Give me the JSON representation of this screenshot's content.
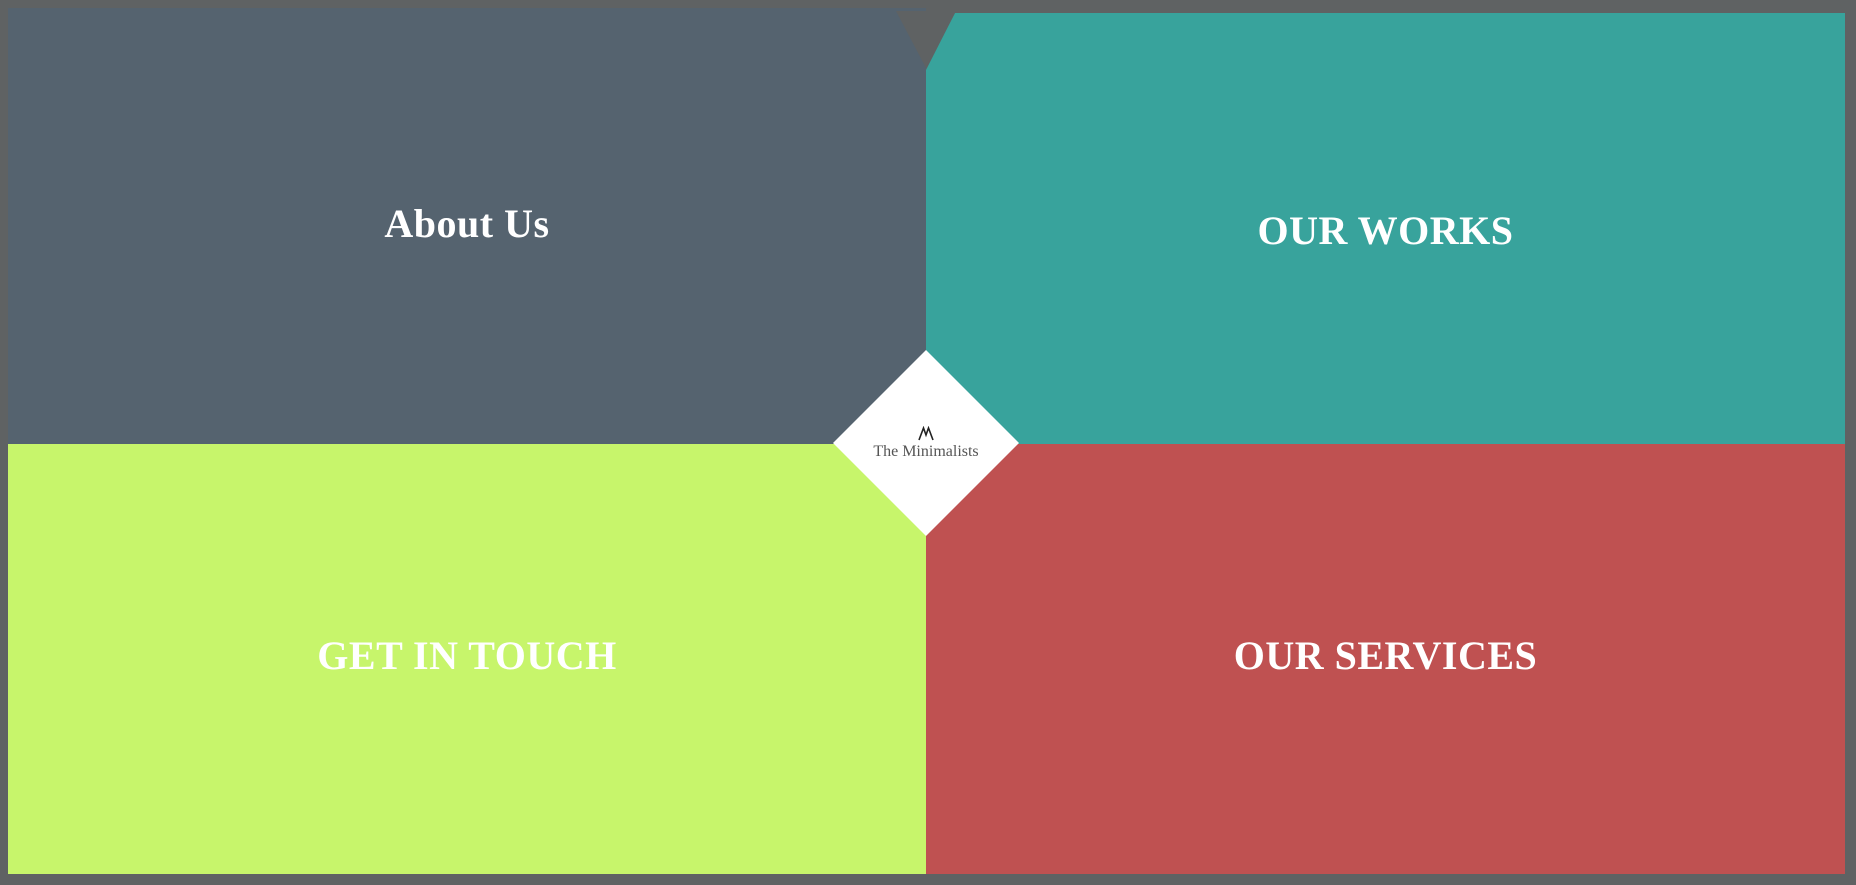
{
  "colors": {
    "frame": "#5f6263",
    "about": "#55636f",
    "works": "#38a39c",
    "contact": "#c7f56b",
    "services": "#bf5151",
    "logo_bg": "#ffffff",
    "title_text": "#ffffff"
  },
  "panels": {
    "about": {
      "title": "About Us"
    },
    "works": {
      "title": "OUR WORKS"
    },
    "contact": {
      "title": "GET IN TOUCH"
    },
    "services": {
      "title": "OUR SERVICES"
    }
  },
  "logo": {
    "icon": "mountain-logo-icon",
    "text": "The Minimalists"
  }
}
